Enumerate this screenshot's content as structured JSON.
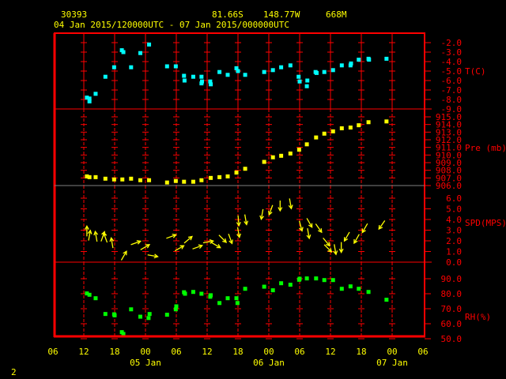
{
  "header": {
    "station_id": "30393",
    "latitude": "81.66S",
    "longitude": "148.77W",
    "elevation": "668M",
    "time_range": "04 Jan 2015/120000UTC - 07 Jan 2015/000000UTC"
  },
  "page_number": "2",
  "colors": {
    "frame": "#ff0000",
    "temperature": "#00ffff",
    "pressure": "#ffff00",
    "wind": "#ffff00",
    "humidity": "#00ff00",
    "text": "#ffff00"
  },
  "chart_data": [
    {
      "type": "scatter",
      "ylabel": "T(C)",
      "ylim": [
        -9.0,
        -2.0
      ],
      "yticks": [
        "-2.0",
        "-3.0",
        "-4.0",
        "-5.0",
        "-6.0",
        "-7.0",
        "-8.0",
        "-9.0"
      ],
      "color": "#00ffff",
      "points": [
        [
          "2015-01-04 12:36",
          -7.8
        ],
        [
          "2015-01-04 13:06",
          -7.9
        ],
        [
          "2015-01-04 13:06",
          -8.2
        ],
        [
          "2015-01-04 14:18",
          -7.4
        ],
        [
          "2015-01-04 16:12",
          -5.6
        ],
        [
          "2015-01-04 17:54",
          -4.6
        ],
        [
          "2015-01-04 19:24",
          -2.8
        ],
        [
          "2015-01-04 19:42",
          -3.0
        ],
        [
          "2015-01-04 21:12",
          -4.6
        ],
        [
          "2015-01-04 23:00",
          -3.1
        ],
        [
          "2015-01-05 00:42",
          -2.2
        ],
        [
          "2015-01-05 04:12",
          -4.5
        ],
        [
          "2015-01-05 05:54",
          -4.5
        ],
        [
          "2015-01-05 07:30",
          -5.5
        ],
        [
          "2015-01-05 07:36",
          -6.0
        ],
        [
          "2015-01-05 09:18",
          -5.6
        ],
        [
          "2015-01-05 10:54",
          -5.6
        ],
        [
          "2015-01-05 11:00",
          -6.1
        ],
        [
          "2015-01-05 10:54",
          -6.3
        ],
        [
          "2015-01-05 12:36",
          -6.1
        ],
        [
          "2015-01-05 12:42",
          -6.4
        ],
        [
          "2015-01-05 14:24",
          -5.1
        ],
        [
          "2015-01-05 16:00",
          -5.4
        ],
        [
          "2015-01-05 17:42",
          -4.7
        ],
        [
          "2015-01-05 18:00",
          -5.0
        ],
        [
          "2015-01-05 19:24",
          -5.4
        ],
        [
          "2015-01-05 23:06",
          -5.1
        ],
        [
          "2015-01-06 00:48",
          -4.9
        ],
        [
          "2015-01-06 02:24",
          -4.6
        ],
        [
          "2015-01-06 04:12",
          -4.4
        ],
        [
          "2015-01-06 05:48",
          -5.6
        ],
        [
          "2015-01-06 06:00",
          -6.1
        ],
        [
          "2015-01-06 07:30",
          -6.0
        ],
        [
          "2015-01-06 07:24",
          -6.6
        ],
        [
          "2015-01-06 09:06",
          -5.1
        ],
        [
          "2015-01-06 09:18",
          -5.2
        ],
        [
          "2015-01-06 10:48",
          -5.1
        ],
        [
          "2015-01-06 12:30",
          -4.9
        ],
        [
          "2015-01-06 14:12",
          -4.4
        ],
        [
          "2015-01-06 15:54",
          -4.4
        ],
        [
          "2015-01-06 16:00",
          -4.2
        ],
        [
          "2015-01-06 17:30",
          -3.8
        ],
        [
          "2015-01-06 19:24",
          -3.7
        ],
        [
          "2015-01-06 19:30",
          -3.8
        ],
        [
          "2015-01-06 22:54",
          -3.7
        ]
      ]
    },
    {
      "type": "scatter",
      "ylabel": "Pre (mb)",
      "ylim": [
        906.0,
        915.0
      ],
      "yticks": [
        "915.0",
        "914.0",
        "913.0",
        "912.0",
        "911.0",
        "910.0",
        "909.0",
        "908.0",
        "907.0",
        "906.0"
      ],
      "color": "#ffff00",
      "points": [
        [
          "2015-01-04 12:36",
          907.2
        ],
        [
          "2015-01-04 13:06",
          907.1
        ],
        [
          "2015-01-04 14:18",
          907.1
        ],
        [
          "2015-01-04 16:12",
          906.9
        ],
        [
          "2015-01-04 17:54",
          906.8
        ],
        [
          "2015-01-04 19:30",
          906.8
        ],
        [
          "2015-01-04 21:12",
          906.9
        ],
        [
          "2015-01-04 23:00",
          906.7
        ],
        [
          "2015-01-05 00:42",
          906.7
        ],
        [
          "2015-01-05 04:12",
          906.4
        ],
        [
          "2015-01-05 05:54",
          906.6
        ],
        [
          "2015-01-05 07:30",
          906.5
        ],
        [
          "2015-01-05 09:18",
          906.5
        ],
        [
          "2015-01-05 10:54",
          906.7
        ],
        [
          "2015-01-05 12:42",
          907.0
        ],
        [
          "2015-01-05 14:24",
          907.1
        ],
        [
          "2015-01-05 16:00",
          907.2
        ],
        [
          "2015-01-05 17:42",
          907.7
        ],
        [
          "2015-01-05 19:24",
          908.2
        ],
        [
          "2015-01-05 23:06",
          909.1
        ],
        [
          "2015-01-06 00:48",
          909.7
        ],
        [
          "2015-01-06 02:24",
          909.9
        ],
        [
          "2015-01-06 04:12",
          910.2
        ],
        [
          "2015-01-06 05:54",
          910.7
        ],
        [
          "2015-01-06 07:24",
          911.4
        ],
        [
          "2015-01-06 09:12",
          912.3
        ],
        [
          "2015-01-06 10:48",
          912.8
        ],
        [
          "2015-01-06 12:30",
          913.1
        ],
        [
          "2015-01-06 14:12",
          913.5
        ],
        [
          "2015-01-06 15:54",
          913.6
        ],
        [
          "2015-01-06 17:30",
          913.9
        ],
        [
          "2015-01-06 19:24",
          914.3
        ],
        [
          "2015-01-06 22:54",
          914.4
        ]
      ]
    },
    {
      "type": "scatter",
      "ylabel": "SPD(MPS)",
      "ylim": [
        0.0,
        6.0
      ],
      "yticks": [
        "6.0",
        "5.0",
        "4.0",
        "3.0",
        "2.0",
        "1.0",
        "0.0"
      ],
      "color": "#ffff00",
      "marker": "wind-arrow",
      "point_fields": [
        "time",
        "speed",
        "arrow_direction_deg"
      ],
      "points": [
        [
          "2015-01-04 12:36",
          2.9,
          0
        ],
        [
          "2015-01-04 13:06",
          2.5,
          10
        ],
        [
          "2015-01-04 14:24",
          2.4,
          350
        ],
        [
          "2015-01-04 15:42",
          2.4,
          20
        ],
        [
          "2015-01-04 16:12",
          2.3,
          340
        ],
        [
          "2015-01-04 17:30",
          1.8,
          350
        ],
        [
          "2015-01-04 19:48",
          0.6,
          30
        ],
        [
          "2015-01-04 22:06",
          1.8,
          70
        ],
        [
          "2015-01-04 23:54",
          1.4,
          60
        ],
        [
          "2015-01-05 01:24",
          0.6,
          100
        ],
        [
          "2015-01-05 05:00",
          2.4,
          70
        ],
        [
          "2015-01-05 06:36",
          1.3,
          60
        ],
        [
          "2015-01-05 08:18",
          2.1,
          50
        ],
        [
          "2015-01-05 10:06",
          1.4,
          70
        ],
        [
          "2015-01-05 12:12",
          1.9,
          80
        ],
        [
          "2015-01-05 13:42",
          1.6,
          120
        ],
        [
          "2015-01-05 15:00",
          2.2,
          135
        ],
        [
          "2015-01-05 16:30",
          2.2,
          160
        ],
        [
          "2015-01-05 18:06",
          2.8,
          170
        ],
        [
          "2015-01-05 18:06",
          3.9,
          175
        ],
        [
          "2015-01-05 19:30",
          4.0,
          170
        ],
        [
          "2015-01-05 22:42",
          4.5,
          190
        ],
        [
          "2015-01-06 00:24",
          4.9,
          200
        ],
        [
          "2015-01-06 02:12",
          5.3,
          180
        ],
        [
          "2015-01-06 04:12",
          5.5,
          170
        ],
        [
          "2015-01-06 06:12",
          3.4,
          165
        ],
        [
          "2015-01-06 07:42",
          2.7,
          170
        ],
        [
          "2015-01-06 07:54",
          3.7,
          150
        ],
        [
          "2015-01-06 09:42",
          3.2,
          145
        ],
        [
          "2015-01-06 11:12",
          1.9,
          140
        ],
        [
          "2015-01-06 11:30",
          1.3,
          135
        ],
        [
          "2015-01-06 12:54",
          1.2,
          170
        ],
        [
          "2015-01-06 14:06",
          1.4,
          180
        ],
        [
          "2015-01-06 15:12",
          2.4,
          210
        ],
        [
          "2015-01-06 17:06",
          2.2,
          210
        ],
        [
          "2015-01-06 18:42",
          3.2,
          210
        ],
        [
          "2015-01-06 22:00",
          3.5,
          215
        ]
      ]
    },
    {
      "type": "scatter",
      "ylabel": "RH(%)",
      "ylim": [
        50.0,
        90.0
      ],
      "yticks": [
        "90.0",
        "80.0",
        "70.0",
        "60.0",
        "50.0"
      ],
      "color": "#00ff00",
      "points": [
        [
          "2015-01-04 12:36",
          80.2
        ],
        [
          "2015-01-04 13:06",
          79.3
        ],
        [
          "2015-01-04 14:18",
          77.0
        ],
        [
          "2015-01-04 16:12",
          66.5
        ],
        [
          "2015-01-04 17:54",
          66.3
        ],
        [
          "2015-01-04 18:00",
          65.6
        ],
        [
          "2015-01-04 19:24",
          54.4
        ],
        [
          "2015-01-04 19:42",
          53.2
        ],
        [
          "2015-01-04 21:12",
          69.6
        ],
        [
          "2015-01-04 23:00",
          64.7
        ],
        [
          "2015-01-05 00:36",
          63.8
        ],
        [
          "2015-01-05 00:48",
          66.5
        ],
        [
          "2015-01-05 04:12",
          66.0
        ],
        [
          "2015-01-05 05:54",
          69.6
        ],
        [
          "2015-01-05 06:00",
          71.6
        ],
        [
          "2015-01-05 07:30",
          81.0
        ],
        [
          "2015-01-05 07:42",
          80.0
        ],
        [
          "2015-01-05 09:18",
          81.2
        ],
        [
          "2015-01-05 10:54",
          80.0
        ],
        [
          "2015-01-05 12:36",
          78.0
        ],
        [
          "2015-01-05 12:42",
          79.0
        ],
        [
          "2015-01-05 14:24",
          73.8
        ],
        [
          "2015-01-05 16:00",
          77.0
        ],
        [
          "2015-01-05 17:42",
          77.0
        ],
        [
          "2015-01-05 17:54",
          73.8
        ],
        [
          "2015-01-05 19:24",
          83.3
        ],
        [
          "2015-01-05 23:06",
          84.7
        ],
        [
          "2015-01-06 00:48",
          82.3
        ],
        [
          "2015-01-06 02:24",
          87.0
        ],
        [
          "2015-01-06 04:12",
          86.0
        ],
        [
          "2015-01-06 05:54",
          89.3
        ],
        [
          "2015-01-06 06:00",
          90.0
        ],
        [
          "2015-01-06 07:24",
          90.2
        ],
        [
          "2015-01-06 09:12",
          90.2
        ],
        [
          "2015-01-06 10:48",
          89.1
        ],
        [
          "2015-01-06 12:30",
          89.1
        ],
        [
          "2015-01-06 14:12",
          83.3
        ],
        [
          "2015-01-06 15:54",
          84.9
        ],
        [
          "2015-01-06 17:30",
          83.3
        ],
        [
          "2015-01-06 19:24",
          81.2
        ],
        [
          "2015-01-06 22:54",
          76.0
        ]
      ]
    }
  ],
  "x_axis": {
    "range": [
      "2015-01-04 06:00",
      "2015-01-07 06:00"
    ],
    "hour_labels": [
      "06",
      "12",
      "18",
      "00",
      "06",
      "12",
      "18",
      "00",
      "06",
      "12",
      "18",
      "00",
      "06"
    ],
    "date_labels": [
      "05 Jan",
      "06 Jan",
      "07 Jan"
    ]
  }
}
